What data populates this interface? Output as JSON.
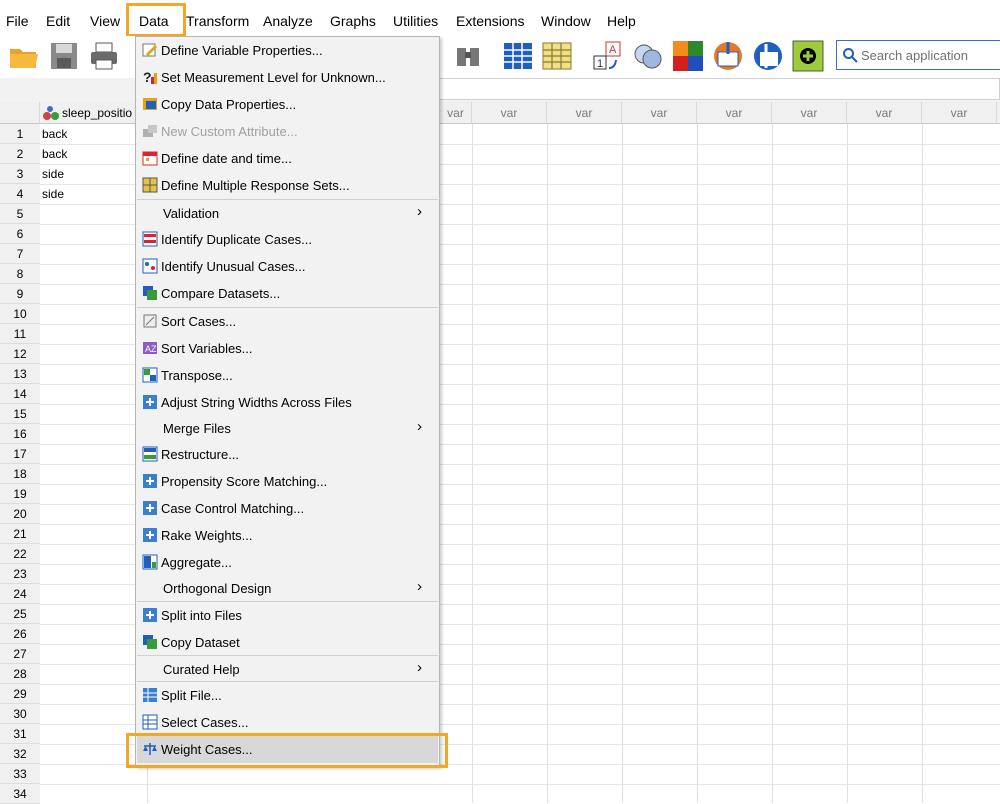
{
  "menubar": {
    "items": [
      "File",
      "Edit",
      "View",
      "Data",
      "Transform",
      "Analyze",
      "Graphs",
      "Utilities",
      "Extensions",
      "Window",
      "Help"
    ],
    "active": "Data"
  },
  "search": {
    "placeholder": "Search application"
  },
  "grid": {
    "first_column": "sleep_positio",
    "var_label": "var",
    "rows": [
      "1",
      "2",
      "3",
      "4",
      "5",
      "6",
      "7",
      "8",
      "9",
      "10",
      "11",
      "12",
      "13",
      "14",
      "15",
      "16",
      "17",
      "18",
      "19",
      "20",
      "21",
      "22",
      "23",
      "24",
      "25",
      "26",
      "27",
      "28",
      "29",
      "30",
      "31",
      "32",
      "33",
      "34"
    ],
    "values": [
      "back",
      "back",
      "side",
      "side"
    ]
  },
  "data_menu": {
    "items": [
      {
        "label": "Define Variable Properties...",
        "icon": "define-variable-properties-icon"
      },
      {
        "label": "Set Measurement Level for Unknown...",
        "icon": "measurement-level-icon"
      },
      {
        "label": "Copy Data Properties...",
        "icon": "copy-data-properties-icon"
      },
      {
        "label": "New Custom Attribute...",
        "icon": "custom-attribute-icon",
        "disabled": true
      },
      {
        "label": "Define date and time...",
        "icon": "calendar-icon"
      },
      {
        "label": "Define Multiple Response Sets...",
        "icon": "multiple-response-icon"
      },
      {
        "label": "Validation",
        "submenu": true
      },
      {
        "label": "Identify Duplicate Cases...",
        "icon": "duplicate-cases-icon"
      },
      {
        "label": "Identify Unusual Cases...",
        "icon": "unusual-cases-icon"
      },
      {
        "label": "Compare Datasets...",
        "icon": "compare-datasets-icon"
      },
      {
        "label": "Sort Cases...",
        "icon": "sort-cases-icon"
      },
      {
        "label": "Sort Variables...",
        "icon": "sort-variables-icon"
      },
      {
        "label": "Transpose...",
        "icon": "transpose-icon"
      },
      {
        "label": "Adjust String Widths Across Files",
        "icon": "plus-icon"
      },
      {
        "label": "Merge Files",
        "submenu": true
      },
      {
        "label": "Restructure...",
        "icon": "restructure-icon"
      },
      {
        "label": "Propensity Score Matching...",
        "icon": "plus-icon"
      },
      {
        "label": "Case Control Matching...",
        "icon": "plus-icon"
      },
      {
        "label": "Rake Weights...",
        "icon": "plus-icon"
      },
      {
        "label": "Aggregate...",
        "icon": "aggregate-icon"
      },
      {
        "label": "Orthogonal Design",
        "submenu": true
      },
      {
        "label": "Split into Files",
        "icon": "plus-icon"
      },
      {
        "label": "Copy Dataset",
        "icon": "copy-dataset-icon"
      },
      {
        "label": "Curated Help",
        "submenu": true
      },
      {
        "label": "Split File...",
        "icon": "split-file-icon"
      },
      {
        "label": "Select Cases...",
        "icon": "select-cases-icon"
      },
      {
        "label": "Weight Cases...",
        "icon": "weight-cases-icon",
        "selected": true
      }
    ]
  },
  "colors": {
    "highlight": "#f5a623",
    "menu_bg": "#f2f2f2",
    "accent_blue": "#3a6fc4"
  }
}
